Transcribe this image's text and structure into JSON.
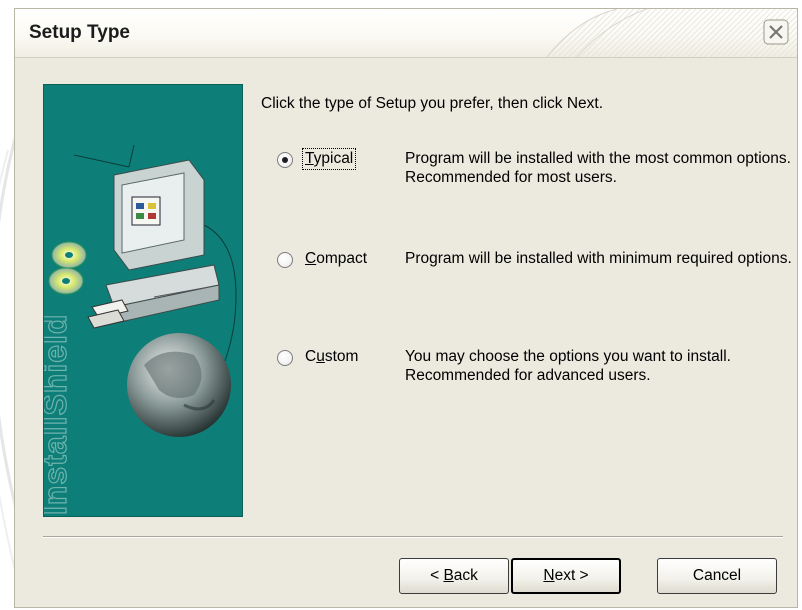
{
  "dialog": {
    "title": "Setup Type",
    "close_icon": "close-icon"
  },
  "banner": {
    "brand_text": "InstallShield"
  },
  "instruction": "Click the type of Setup you prefer, then click Next.",
  "options": [
    {
      "label_pre": "",
      "mnemonic": "T",
      "label_post": "ypical",
      "description": "Program will be installed with the most common options.  Recommended for most users.",
      "selected": true
    },
    {
      "label_pre": "",
      "mnemonic": "C",
      "label_post": "ompact",
      "description": "Program will be installed with minimum required options.",
      "selected": false
    },
    {
      "label_pre": "C",
      "mnemonic": "u",
      "label_post": "stom",
      "description": "You may choose the options you want to install. Recommended for advanced users.",
      "selected": false
    }
  ],
  "buttons": {
    "back_pre": "< ",
    "back_mnemonic": "B",
    "back_post": "ack",
    "next_mnemonic": "N",
    "next_post": "ext >",
    "cancel": "Cancel"
  },
  "colors": {
    "banner_teal": "#0e7f78",
    "dialog_bg": "#eceade"
  }
}
